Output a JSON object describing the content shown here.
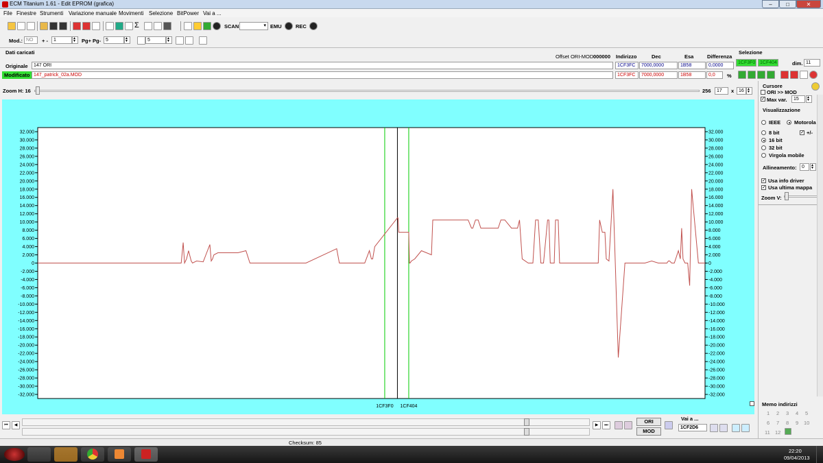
{
  "window": {
    "title": "ECM Titanium 1.61 - Edit EPROM (grafica)"
  },
  "menu": [
    "File",
    "Finestre",
    "Strumenti",
    "Variazione manuale",
    "Movimenti",
    "Selezione",
    "BitPower",
    "Vai a ..."
  ],
  "toolbar": {
    "scan_label": "SCAN",
    "emu_label": "EMU",
    "rec_label": "REC"
  },
  "toolbar2": {
    "mod_label": "Mod.:",
    "mod_value": "NO",
    "plusminus_label": "+ -",
    "plusminus_value": "1",
    "pg_label": "Pg+ Pg-",
    "pg_value": "5",
    "box3_value": "5"
  },
  "loaded": {
    "title": "Dati caricati",
    "offset_label": "Offset ORI-MOD",
    "offset_value": "000000",
    "headers": {
      "indirizzo": "Indirizzo",
      "dec": "Dec",
      "esa": "Esa",
      "differenza": "Differenza"
    },
    "rows": [
      {
        "label": "Originale",
        "file": "147 ORI",
        "indirizzo": "1CF3FC",
        "dec": "7000,0000",
        "esa": "1B58",
        "diff": "0,0000"
      },
      {
        "label": "Modificato",
        "file": "147_patrick_02a.MOD",
        "indirizzo": "1CF3FC",
        "dec": "7000,0000",
        "esa": "1B58",
        "diff": "0,0"
      }
    ],
    "percent_icon": "%"
  },
  "selezione": {
    "title": "Selezione",
    "start": "1CF3F0",
    "end": "1CF404",
    "dim_label": "dim.",
    "dim_value": "11"
  },
  "zoom": {
    "label": "Zoom H: 16",
    "value": "256",
    "count": "17",
    "x_label": "x",
    "factor": "16"
  },
  "side": {
    "cursore_title": "Cursore",
    "ori_mod": "ORI >> MOD",
    "max_var_label": "Max var.",
    "max_var_value": "15",
    "vis_title": "Visualizzazione",
    "ieee": "IEEE",
    "motorola": "Motorola",
    "bit8": "8 bit",
    "plusminus": "+/-",
    "bit16": "16 bit",
    "bit32": "32 bit",
    "virgola": "Virgola mobile",
    "allineamento_label": "Allineamento:",
    "allineamento_value": "0",
    "usa_info": "Usa info driver",
    "usa_ultima": "Usa ultima mappa",
    "zoomv_label": "Zoom V:",
    "memo_title": "Memo indirizzi",
    "memo_nums": [
      "1",
      "2",
      "3",
      "4",
      "5",
      "6",
      "7",
      "8",
      "9",
      "10",
      "11",
      "12"
    ]
  },
  "bottom": {
    "ori_btn": "ORI",
    "mod_btn": "MOD",
    "vai_label": "Vai a ...",
    "vai_value": "1CF2D6",
    "checksum": "Checksum: 85"
  },
  "taskbar": {
    "time": "22:20",
    "date": "09/04/2013"
  },
  "colors": {
    "plot_bg": "#80ffff",
    "line": "#c0504d",
    "selection": "#00cc00",
    "cursor": "#000000",
    "green_field": "#33dd33"
  },
  "chart_data": {
    "type": "line",
    "ylim": [
      -33000,
      33000
    ],
    "yticks": [
      32000,
      30000,
      28000,
      26000,
      24000,
      22000,
      20000,
      18000,
      16000,
      14000,
      12000,
      10000,
      8000,
      6000,
      4000,
      2000,
      0,
      -2000,
      -4000,
      -6000,
      -8000,
      -10000,
      -12000,
      -14000,
      -16000,
      -18000,
      -20000,
      -22000,
      -24000,
      -26000,
      -28000,
      -30000,
      -32000
    ],
    "ytick_labels": [
      "32.000",
      "30.000",
      "28.000",
      "26.000",
      "24.000",
      "22.000",
      "20.000",
      "18.000",
      "16.000",
      "14.000",
      "12.000",
      "10.000",
      "8.000",
      "6.000",
      "4.000",
      "2.000",
      "0",
      "-2.000",
      "-4.000",
      "-6.000",
      "-8.000",
      "-10.000",
      "-12.000",
      "-14.000",
      "-16.000",
      "-18.000",
      "-20.000",
      "-22.000",
      "-24.000",
      "-26.000",
      "-28.000",
      "-30.000",
      "-32.000"
    ],
    "xlim": [
      0,
      1000
    ],
    "x_markers": [
      {
        "label": "1CF3F0",
        "x": 520
      },
      {
        "label": "1CF404",
        "x": 556
      }
    ],
    "cursor_x": 539,
    "series": [
      {
        "x": [
          0,
          215,
          218,
          220,
          223,
          226,
          230,
          232,
          238,
          248,
          252,
          258,
          260,
          262,
          264,
          270,
          300,
          312,
          318,
          390,
          400,
          402,
          448,
          452,
          454,
          458,
          470,
          480,
          490,
          497,
          500,
          502,
          505,
          539,
          540,
          541,
          556,
          557,
          558,
          560,
          565,
          575,
          590,
          592,
          594,
          597,
          600,
          640,
          645,
          650,
          652,
          656,
          660,
          664,
          670,
          672,
          676,
          690,
          694,
          700,
          710,
          714,
          719,
          722,
          726,
          735,
          742,
          746,
          750,
          754,
          758,
          764,
          766,
          768,
          774,
          776,
          780,
          782,
          790,
          800,
          840,
          842,
          846,
          850,
          852,
          856,
          862,
          870,
          880,
          890,
          900,
          910,
          920,
          930,
          940,
          943,
          945,
          947,
          950,
          954,
          957,
          960,
          963,
          965,
          967,
          970,
          972,
          974,
          977,
          980,
          990,
          1000
        ],
        "y": [
          0,
          0,
          5000,
          0,
          1000,
          3000,
          500,
          0,
          500,
          300,
          2000,
          4500,
          500,
          1000,
          2000,
          2500,
          2500,
          3000,
          0,
          0,
          0,
          0,
          3500,
          0,
          0,
          0,
          0,
          0,
          0,
          3000,
          1000,
          1000,
          4000,
          11000,
          11000,
          7500,
          7500,
          0,
          0,
          500,
          1000,
          3000,
          2000,
          10500,
          10500,
          10500,
          10500,
          10500,
          10500,
          8500,
          8500,
          10500,
          10500,
          8500,
          8500,
          8500,
          8500,
          8500,
          10500,
          10500,
          8500,
          8500,
          8500,
          10500,
          1000,
          0,
          0,
          10500,
          10500,
          0,
          0,
          10500,
          10500,
          0,
          0,
          10500,
          10500,
          0,
          0,
          0,
          0,
          10500,
          7500,
          7500,
          1000,
          500,
          18000,
          -23000,
          0,
          0,
          0,
          0,
          500,
          0,
          0,
          0,
          500,
          500,
          0,
          0,
          1500,
          3000,
          1000,
          8500,
          1000,
          0,
          0,
          0,
          -5500,
          18000,
          0,
          0
        ]
      }
    ]
  }
}
